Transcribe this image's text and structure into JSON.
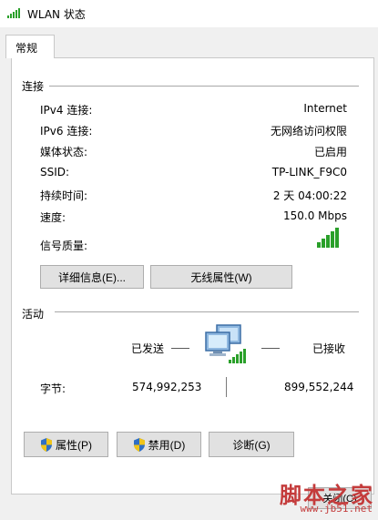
{
  "window": {
    "title": "WLAN 状态",
    "icon": "wifi-signal-icon"
  },
  "tabs": [
    {
      "label": "常规",
      "active": true
    }
  ],
  "connection": {
    "section_label": "连接",
    "rows": [
      {
        "label": "IPv4 连接:",
        "value": "Internet"
      },
      {
        "label": "IPv6 连接:",
        "value": "无网络访问权限"
      },
      {
        "label": "媒体状态:",
        "value": "已启用"
      },
      {
        "label": "SSID:",
        "value": "TP-LINK_F9C0"
      },
      {
        "label": "持续时间:",
        "value": "2 天 04:00:22"
      },
      {
        "label": "速度:",
        "value": "150.0 Mbps"
      }
    ],
    "signal_label": "信号质量:",
    "signal_bars_lit": 5,
    "signal_bars_total": 5,
    "details_button": "详细信息(E)...",
    "wireless_props_button": "无线属性(W)"
  },
  "activity": {
    "section_label": "活动",
    "sent_label": "已发送",
    "received_label": "已接收",
    "bytes_label": "字节:",
    "bytes_sent": "574,992,253",
    "bytes_received": "899,552,244"
  },
  "buttons": {
    "properties": "属性(P)",
    "disable": "禁用(D)",
    "diagnose": "诊断(G)",
    "close": "关闭(C)"
  },
  "watermark": {
    "text": "脚本之家",
    "url": "www.jb51.net"
  },
  "colors": {
    "signal_green": "#2aa02a",
    "shield_blue": "#2f6fc4",
    "shield_yellow": "#f0c419"
  }
}
